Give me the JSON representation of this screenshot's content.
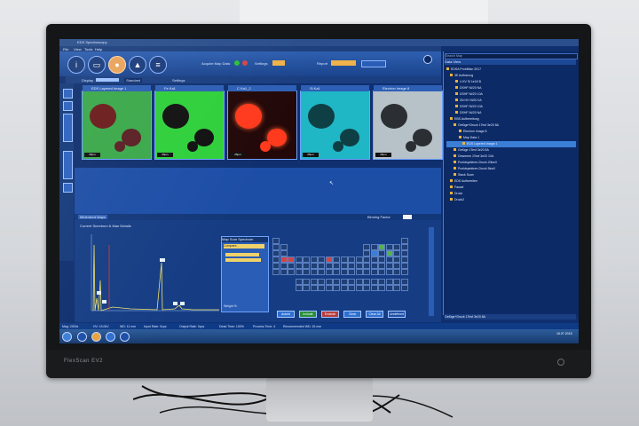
{
  "monitor": {
    "brand": "FlexScan EV2",
    "bg": "#151618"
  },
  "app": {
    "title": "EDS Spectroscopy",
    "menu": [
      "File",
      "View",
      "Tools",
      "Help"
    ],
    "toolbar": {
      "acquire_label": "Acquire Map Data",
      "settings_label": "Settings",
      "report_label": "Report"
    },
    "display": {
      "label": "Display",
      "mode": "Standard",
      "settings": "Settings"
    },
    "tiles": [
      {
        "title": "EDS Layered Image 1",
        "scale": "25µm",
        "color": "#3aa84a"
      },
      {
        "title": "Fe Ka1",
        "scale": "25µm",
        "color": "#2fcf3b"
      },
      {
        "title": "C Ka1_2",
        "scale": "25µm",
        "color": "#e02a1a"
      },
      {
        "title": "Si Ka1",
        "scale": "25µm",
        "color": "#1fb6c6"
      },
      {
        "title": "Electron Image 8",
        "scale": "25µm",
        "color": "#b7c1c8"
      }
    ],
    "lower": {
      "tab": "Minimized Maps",
      "binning_label": "Binning Factor",
      "spectrum_title": "Current Spectrum & Map Details",
      "sum_title": "Map Sum Spectrum",
      "sum_selected": "Compare...",
      "weight_label": "Weight %",
      "buttons": [
        "Autoid",
        "Include",
        "Exclude",
        "Clear",
        "Clear All",
        "Undefined"
      ]
    },
    "right": {
      "search": "Search Map",
      "header": "Data View",
      "tree": [
        "EDSA ProbiMan 2017",
        "3E Aufbarung",
        "4 HV Si 1e18 B",
        "DSHF Ni/20 NA",
        "DSHF Ni/20 10A",
        "2N HV Ni/20 0A",
        "DSHF Ni/20 10A",
        "DSHF Ni/20 NA",
        "EBS Aufbereitung",
        "Gefüge+Druck 1Tesf 3e20 8A",
        "Electron Image 8",
        "Map Data 1",
        "EDS Layered Image 1",
        "Gefüge 1Tesf 3e20 8A",
        "Gewenen 1Tesf 3e20 10A",
        "Punktspektren-Druck 20kwV",
        "Punktspektren-Druck 5kwV",
        "Stack Scan",
        "EDS Aufbereiten",
        "Fassel",
        "Druck",
        "Druck2"
      ],
      "footer": "Gefüge+Druck 1Tesf 3e20 8A"
    },
    "status": {
      "mag": "Mag: 2000x",
      "hv": "HV: 15.0kV",
      "wd": "WD: 11 mm",
      "input": "Input Rate: 0cps",
      "output": "Output Rate: 0cps",
      "dead": "Dead Time: 100%",
      "process": "Process Time: 4",
      "recommended": "Recommended WD: 15 mm"
    },
    "taskbar": {
      "clock": "16.07.2018"
    }
  }
}
